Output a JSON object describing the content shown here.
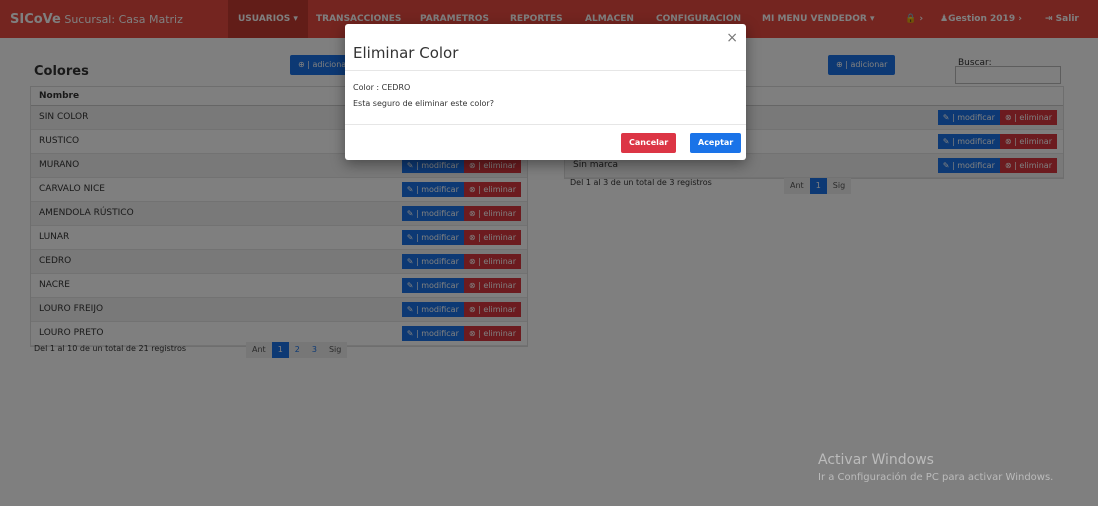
{
  "navbar": {
    "brand_logo": "SICoVe",
    "brand_branch": "Sucursal: Casa Matriz",
    "items": [
      {
        "label": "USUARIOS ▾"
      },
      {
        "label": "TRANSACCIONES"
      },
      {
        "label": "PARAMETROS"
      },
      {
        "label": "REPORTES"
      },
      {
        "label": "ALMACEN"
      },
      {
        "label": "CONFIGURACION"
      },
      {
        "label": "MI MENU VENDEDOR ▾"
      }
    ],
    "lock_icon": "🔒 ›",
    "gestion": "♟Gestion 2019 ›",
    "salir": "⇥ Salir"
  },
  "colors_panel": {
    "title": "Colores",
    "add_label": "⊕ | adicionar",
    "column_header": "Nombre",
    "rows": [
      {
        "name": "SIN COLOR"
      },
      {
        "name": "RUSTICO"
      },
      {
        "name": "MURANO"
      },
      {
        "name": "CARVALO NICE"
      },
      {
        "name": "AMENDOLA RÚSTICO"
      },
      {
        "name": "LUNAR"
      },
      {
        "name": "CEDRO"
      },
      {
        "name": "NACRE"
      },
      {
        "name": "LOURO FREIJO"
      },
      {
        "name": "LOURO PRETO"
      }
    ],
    "modify_label": "✎ | modificar",
    "delete_label": "⊗ | eliminar",
    "summary": "Del 1 al 10 de un total de 21 registros",
    "pager": [
      "Ant",
      "1",
      "2",
      "3",
      "Sig"
    ]
  },
  "brands_panel": {
    "add_label": "⊕ | adicionar",
    "search_label": "Buscar:",
    "search_value": "",
    "rows": [
      {
        "name": ""
      },
      {
        "name": ""
      },
      {
        "name": "Sin marca"
      }
    ],
    "modify_label": "✎ | modificar",
    "delete_label": "⊗ | eliminar",
    "summary": "Del 1 al 3 de un total de 3 registros",
    "pager": [
      "Ant",
      "1",
      "Sig"
    ]
  },
  "modal": {
    "title": "Eliminar Color",
    "close": "×",
    "line1": "Color : CEDRO",
    "line2": "Esta seguro de eliminar este color?",
    "cancel_label": "Cancelar",
    "ok_label": "Aceptar"
  },
  "watermark": {
    "line1": "Activar Windows",
    "line2": "Ir a Configuración de PC para activar Windows."
  }
}
